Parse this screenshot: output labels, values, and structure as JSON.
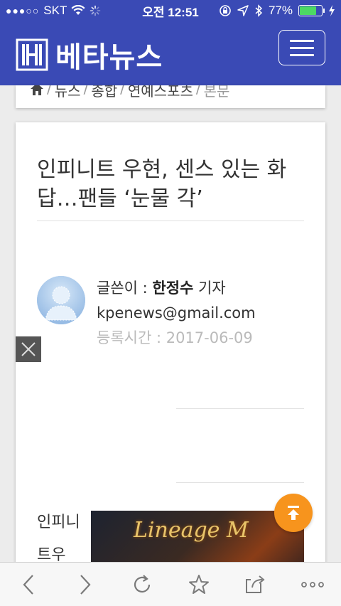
{
  "status_bar": {
    "signal": "●●●○○",
    "carrier": "SKT",
    "time": "오전 12:51",
    "battery": "77%",
    "battery_level": 0.77
  },
  "header": {
    "logo_text": "베타뉴스",
    "logo_icon": "hangul-h-logo",
    "menu_icon": "hamburger-menu-icon",
    "brand_color": "#3a4ab5"
  },
  "breadcrumb": {
    "home_icon": "home-icon",
    "items": [
      "뉴스",
      "종합",
      "연예스포츠",
      "본문"
    ],
    "separator": "/"
  },
  "article": {
    "title": "인피니트 우현, 센스 있는 화답…팬들 ‘눈물 각’",
    "author_label": "글쓴이 : ",
    "author_name": "한정수",
    "author_suffix": " 기자",
    "email": "kpenews@gmail.com",
    "date_label": "등록시간 : ",
    "date": "2017-06-09",
    "body_start": "인피니트우"
  },
  "ad": {
    "logo_text": "Lineage M",
    "close_icon": "close-icon"
  },
  "scroll_top_icon": "arrow-up-to-top-icon",
  "accent_color": "#f7941d",
  "toolbar": {
    "items": [
      "back-icon",
      "forward-icon",
      "reload-icon",
      "bookmark-star-icon",
      "share-icon",
      "more-icon"
    ]
  }
}
